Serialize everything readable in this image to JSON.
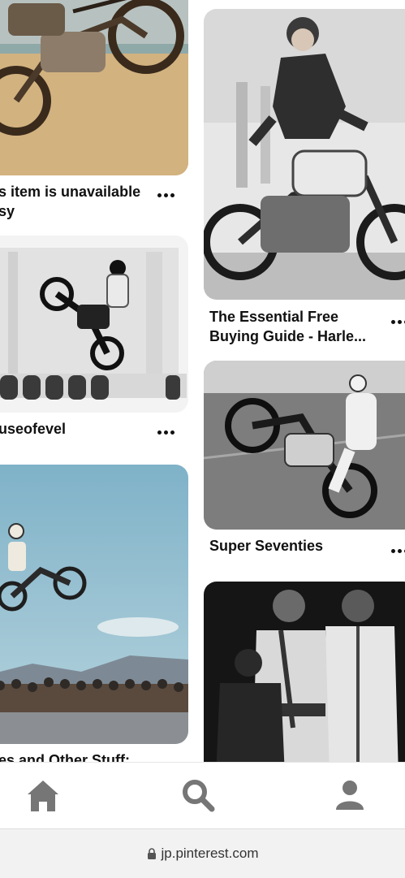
{
  "pins": [
    {
      "id": "moto-sepia",
      "title": "s item is unavailable\nsy"
    },
    {
      "id": "essential",
      "title": "The Essential Free\nBuying Guide - Harle..."
    },
    {
      "id": "jump-bw",
      "title": "useofevel"
    },
    {
      "id": "super-seventies",
      "title": "Super Seventies"
    },
    {
      "id": "jump-color",
      "title": "es and Other Stuff:"
    },
    {
      "id": "two-men",
      "title": ""
    }
  ],
  "nav": {
    "home": "home-icon",
    "search": "search-icon",
    "profile": "profile-icon"
  },
  "browser": {
    "url": "jp.pinterest.com",
    "lock_icon": "lock-icon"
  },
  "colors": {
    "nav_icon": "#767676",
    "text": "#111111",
    "url_bar_bg": "#f2f2f2"
  }
}
